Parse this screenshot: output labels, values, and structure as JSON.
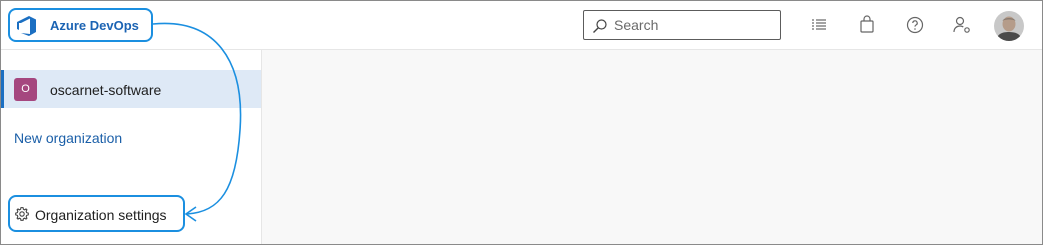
{
  "header": {
    "brand_name": "Azure DevOps",
    "search_placeholder": "Search",
    "icons": [
      "work-items-icon",
      "marketplace-bag-icon",
      "help-icon",
      "user-settings-icon",
      "user-avatar"
    ]
  },
  "sidebar": {
    "organization": {
      "initial": "O",
      "name": "oscarnet-software",
      "color": "#a5477f"
    },
    "new_organization_label": "New organization",
    "settings_label": "Organization settings"
  },
  "colors": {
    "accent": "#1b6fc2",
    "callout": "#1b8fe0",
    "selected_background": "#dee9f6",
    "content_background": "#f8f8f8"
  }
}
